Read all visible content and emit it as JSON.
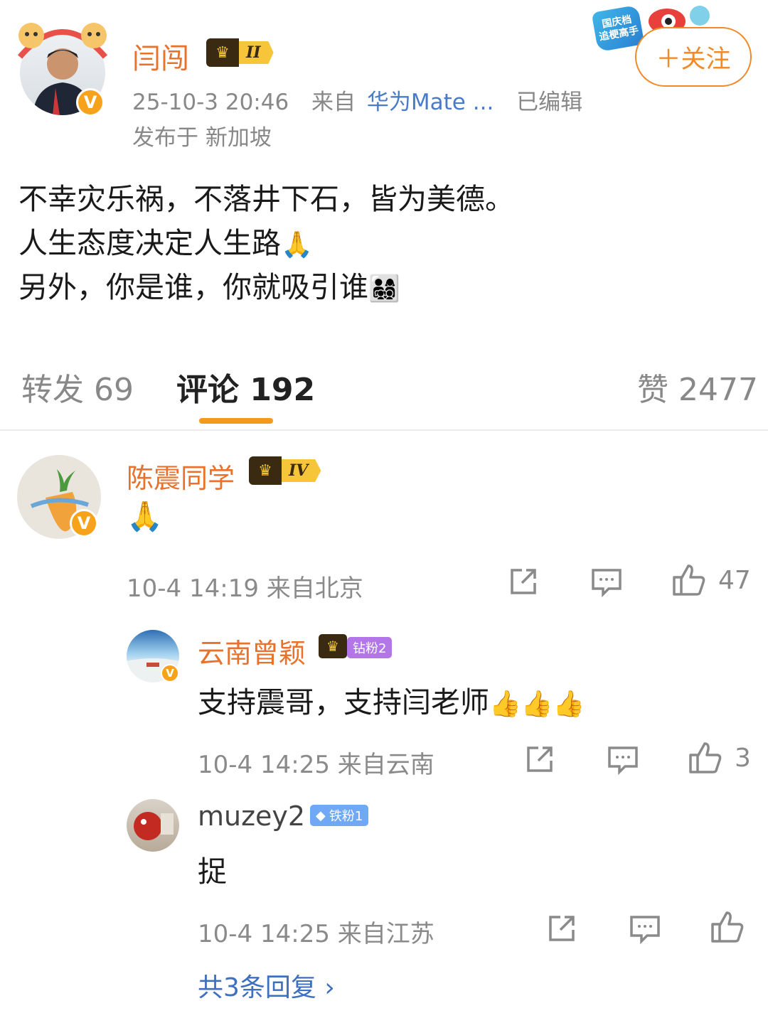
{
  "post": {
    "author": "闫闯",
    "level_badge": "II",
    "festival_badge": "国庆档\n追梗高手",
    "date": "25-10-3 20:46",
    "from_prefix": "来自",
    "device": "华为Mate ...",
    "edited": "已编辑",
    "location": "发布于 新加坡",
    "follow_label": "＋关注",
    "lines": [
      "不幸灾乐祸，不落井下石，皆为美德。",
      "人生态度决定人生路",
      "另外，你是谁，你就吸引谁"
    ],
    "line_emojis": [
      "",
      "🙏",
      "👨‍👩‍👧‍👦"
    ],
    "verified_mark": "V"
  },
  "tabs": {
    "repost": "转发 69",
    "comment": "评论 192",
    "like": "赞 2477"
  },
  "comments": [
    {
      "name": "陈震同学",
      "level_badge": "IV",
      "text": "🙏",
      "meta": "10-4 14:19  来自北京",
      "likes": "47"
    }
  ],
  "replies": [
    {
      "name": "云南曾颖",
      "fan_badge": "钻粉2",
      "text": "支持震哥，支持闫老师",
      "text_emojis": "👍👍👍",
      "meta": "10-4 14:25  来自云南",
      "likes": "3"
    },
    {
      "name": "muzey2",
      "fan_badge": "铁粉1",
      "text": "捉",
      "meta": "10-4 14:25  来自江苏",
      "likes": ""
    }
  ],
  "more_replies": "共3条回复 ›",
  "colors": {
    "accent_orange": "#e8722b",
    "link_blue": "#3f6fbf",
    "tab_underline": "#f39a1d"
  }
}
